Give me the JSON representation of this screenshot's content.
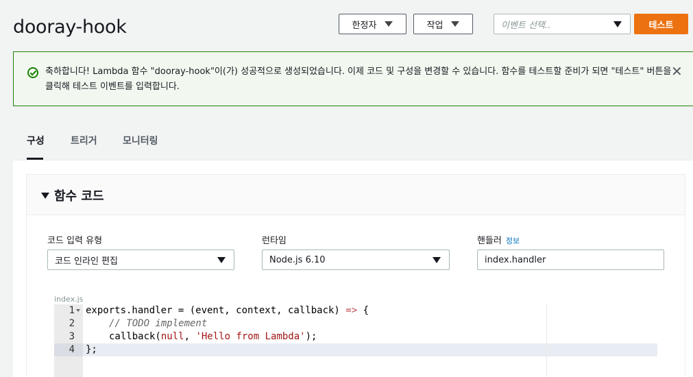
{
  "header": {
    "title": "dooray-hook",
    "qualifier_label": "한정자",
    "actions_label": "작업",
    "event_placeholder": "이벤트 선택..",
    "test_label": "테스트"
  },
  "flash": {
    "message": "축하합니다! Lambda 함수 \"dooray-hook\"이(가) 성공적으로 생성되었습니다. 이제 코드 및 구성을 변경할 수 있습니다. 함수를 테스트할 준비가 되면 \"테스트\" 버튼을 클릭해 테스트 이벤트를 입력합니다.",
    "close_glyph": "✕"
  },
  "tabs": [
    {
      "label": "구성",
      "active": true
    },
    {
      "label": "트리거",
      "active": false
    },
    {
      "label": "모니터링",
      "active": false
    }
  ],
  "function_code": {
    "heading": "함수 코드",
    "code_entry_label": "코드 입력 유형",
    "code_entry_value": "코드 인라인 편집",
    "runtime_label": "런타임",
    "runtime_value": "Node.js 6.10",
    "handler_label": "핸들러",
    "handler_info": "정보",
    "handler_value": "index.handler"
  },
  "editor": {
    "filename": "index.js",
    "line_numbers": [
      "1",
      "2",
      "3",
      "4"
    ],
    "lines": [
      {
        "a": "exports.handler = (event, context, callback) ",
        "b": "=>",
        "c": " {"
      },
      {
        "comment": "// TODO implement"
      },
      {
        "pre": "callback(",
        "null": "null",
        "mid": ", ",
        "str": "'Hello from Lambda'",
        "post": ");"
      },
      {
        "text": "};"
      }
    ]
  },
  "colors": {
    "accent": "#ec7211",
    "success": "#1d8102",
    "link": "#0073bb"
  }
}
